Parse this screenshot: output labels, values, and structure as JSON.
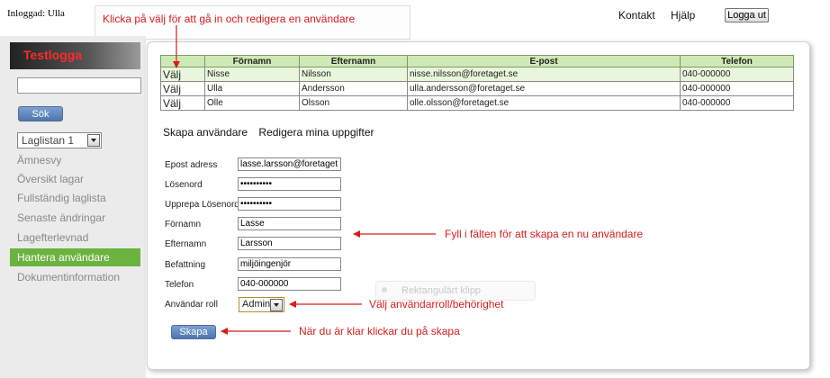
{
  "header": {
    "logged_in": "Inloggad: Ulla",
    "links": [
      "Kontakt",
      "Hjälp"
    ],
    "logout_label": "Logga ut"
  },
  "sidebar": {
    "logo_text": "Testlogga",
    "search_value": "",
    "search_button": "Sök",
    "laglist_value": "Laglistan 1",
    "items": [
      {
        "label": "Ämnesvy",
        "active": false
      },
      {
        "label": "Översikt lagar",
        "active": false
      },
      {
        "label": "Fullständig laglista",
        "active": false
      },
      {
        "label": "Senaste ändringar",
        "active": false
      },
      {
        "label": "Lagefterlevnad",
        "active": false
      },
      {
        "label": "Hantera användare",
        "active": true
      },
      {
        "label": "Dokumentinformation",
        "active": false
      }
    ]
  },
  "users_table": {
    "headers": [
      "",
      "Förnamn",
      "Efternamn",
      "E-post",
      "Telefon"
    ],
    "select_label": "Välj",
    "rows": [
      {
        "first": "Nisse",
        "last": "Nilsson",
        "email": "nisse.nilsson@foretaget.se",
        "phone": "040-000000"
      },
      {
        "first": "Ulla",
        "last": "Andersson",
        "email": "ulla.andersson@foretaget.se",
        "phone": "040-000000"
      },
      {
        "first": "Olle",
        "last": "Olsson",
        "email": "olle.olsson@foretaget.se",
        "phone": "040-000000"
      }
    ]
  },
  "tabs": [
    "Skapa användare",
    "Redigera mina uppgifter"
  ],
  "form": {
    "email_label": "Epost adress",
    "email_value": "lasse.larsson@foretaget.se",
    "password_label": "Lösenord",
    "password_value": "••••••••••",
    "repeat_label": "Upprepa Lösenord",
    "repeat_value": "••••••••••",
    "first_label": "Förnamn",
    "first_value": "Lasse",
    "last_label": "Efternamn",
    "last_value": "Larsson",
    "title_label": "Befattning",
    "title_value": "miljöingenjör",
    "phone_label": "Telefon",
    "phone_value": "040-000000",
    "role_label": "Användar roll",
    "role_value": "Admin",
    "create_label": "Skapa"
  },
  "annotations": {
    "select": "Klicka på välj för att gå in och redigera en användare",
    "fill": "Fyll i fälten för att skapa en nu användare",
    "role": "Välj användarroll/behörighet",
    "create": "När du är klar klickar du på skapa",
    "ghost": "Rektangulärt klipp"
  },
  "colors": {
    "active_nav": "#6bb33f",
    "annotation": "#d81c1c",
    "table_header": "#cfe9b5"
  }
}
